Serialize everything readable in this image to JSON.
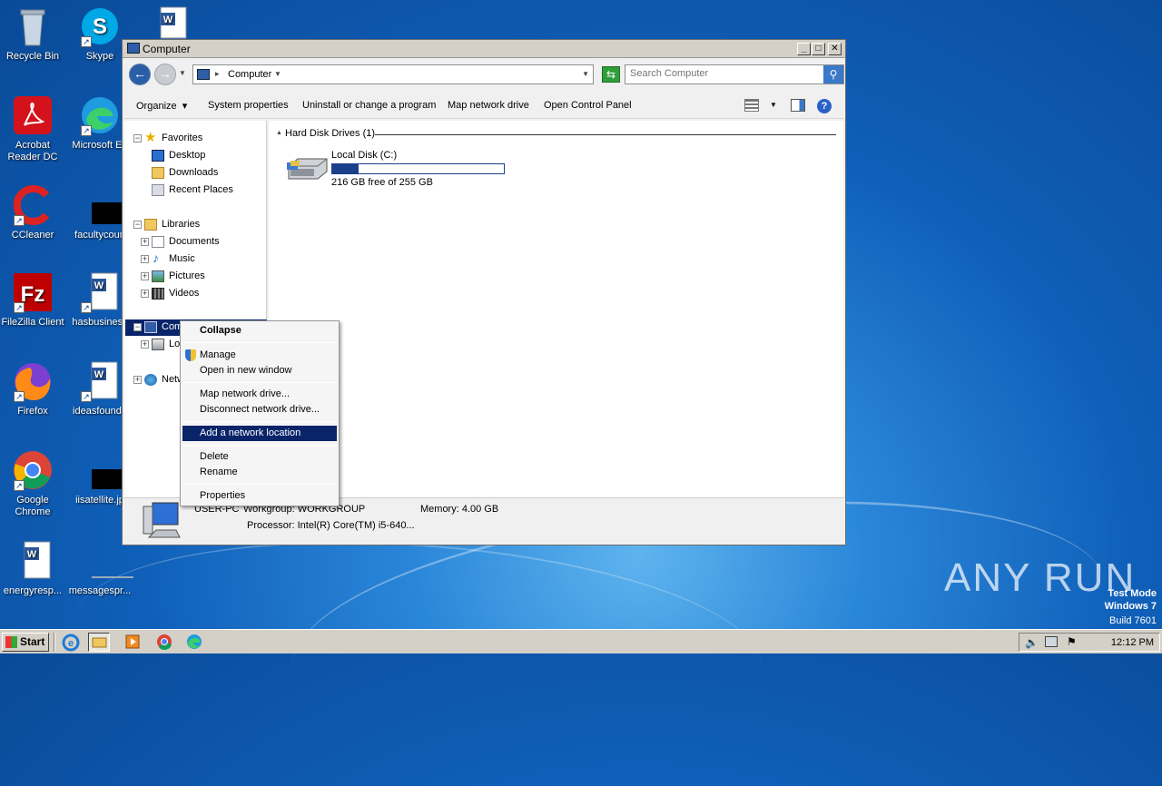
{
  "desktop": {
    "icons": [
      {
        "label": "Recycle Bin",
        "icon": "recycle-bin-icon"
      },
      {
        "label": "Skype",
        "icon": "skype-icon"
      },
      {
        "label": "Acrobat Reader DC",
        "icon": "acrobat-icon"
      },
      {
        "label": "Microsoft Ed",
        "icon": "edge-icon"
      },
      {
        "label": "CCleaner",
        "icon": "ccleaner-icon"
      },
      {
        "label": "facultycoun",
        "icon": "document-icon"
      },
      {
        "label": "FileZilla Client",
        "icon": "filezilla-icon"
      },
      {
        "label": "hasbusiness",
        "icon": "word-doc-icon"
      },
      {
        "label": "Firefox",
        "icon": "firefox-icon"
      },
      {
        "label": "ideasfounda",
        "icon": "word-doc-icon"
      },
      {
        "label": "Google Chrome",
        "icon": "chrome-icon"
      },
      {
        "label": "iisatellite.jp",
        "icon": "image-file-icon"
      },
      {
        "label": "energyresp...",
        "icon": "word-doc-icon"
      },
      {
        "label": "messagespr...",
        "icon": "file-icon"
      }
    ]
  },
  "window": {
    "title": "Computer",
    "address": "Computer",
    "search_placeholder": "Search Computer",
    "toolbar": {
      "organize": "Organize",
      "system_properties": "System properties",
      "uninstall": "Uninstall or change a program",
      "map_drive": "Map network drive",
      "control_panel": "Open Control Panel"
    },
    "nav": {
      "favorites": "Favorites",
      "desktop": "Desktop",
      "downloads": "Downloads",
      "recent": "Recent Places",
      "libraries": "Libraries",
      "documents": "Documents",
      "music": "Music",
      "pictures": "Pictures",
      "videos": "Videos",
      "computer": "Comp",
      "local": "Lo",
      "network": "Netw"
    },
    "content": {
      "group_header": "Hard Disk Drives (1)",
      "drive_name": "Local Disk (C:)",
      "drive_free": "216 GB free of 255 GB",
      "drive_used_fraction": 0.153
    },
    "status": {
      "computer_name": "USER-PC",
      "workgroup": "Workgroup: WORKGROUP",
      "memory": "Memory: 4.00 GB",
      "processor": "Processor: Intel(R) Core(TM) i5-640..."
    }
  },
  "context_menu": {
    "collapse": "Collapse",
    "manage": "Manage",
    "open_new_window": "Open in new window",
    "map_drive": "Map network drive...",
    "disconnect_drive": "Disconnect network drive...",
    "add_network_location": "Add a network location",
    "delete": "Delete",
    "rename": "Rename",
    "properties": "Properties"
  },
  "taskbar": {
    "start": "Start",
    "clock": "12:12 PM"
  },
  "watermark": {
    "brand": "ANY RUN",
    "line1": "Test Mode",
    "line2": "Windows 7",
    "line3": "Build 7601"
  },
  "colors": {
    "highlight": "#0a246a",
    "drive_bar": "#1c3f8c"
  }
}
